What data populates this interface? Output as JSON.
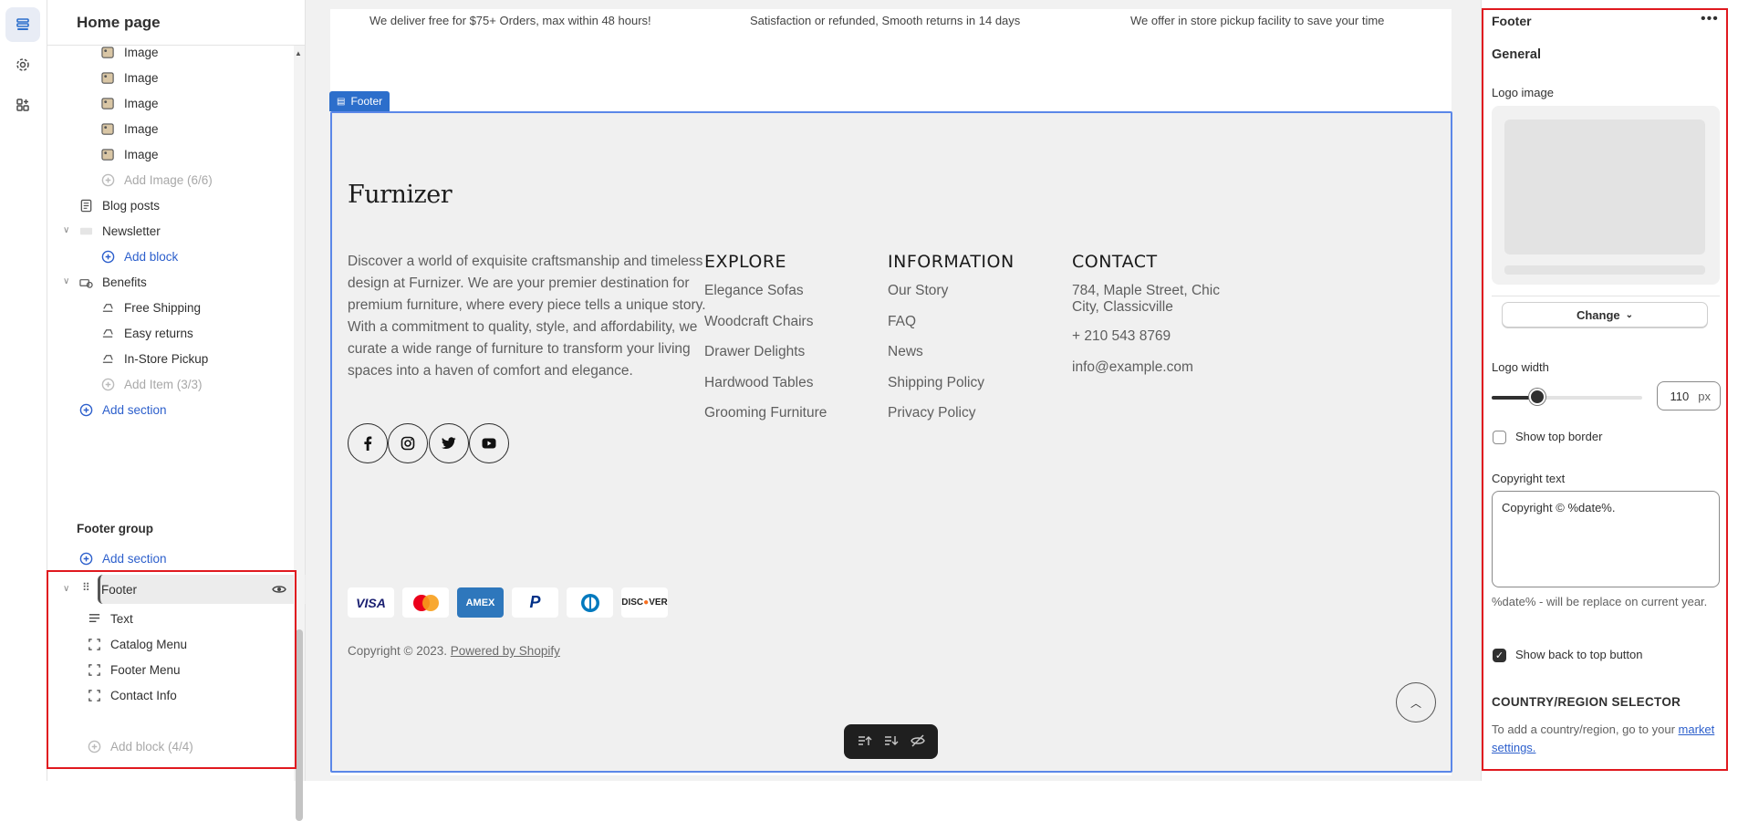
{
  "sidebar": {
    "title": "Home page",
    "tree_top": [
      {
        "label": "Image",
        "icon": "image-thumb-icon"
      },
      {
        "label": "Image",
        "icon": "image-thumb-icon"
      },
      {
        "label": "Image",
        "icon": "image-thumb-icon"
      },
      {
        "label": "Image",
        "icon": "image-thumb-icon"
      },
      {
        "label": "Image",
        "icon": "image-thumb-icon"
      },
      {
        "label": "Add Image (6/6)",
        "icon": "plus-circle-icon"
      },
      {
        "label": "Blog posts",
        "icon": "blog-icon"
      },
      {
        "label": "Newsletter",
        "icon": "newsletter-icon"
      },
      {
        "label": "Add block",
        "icon": "plus-circle-icon"
      },
      {
        "label": "Benefits",
        "icon": "benefits-icon"
      },
      {
        "label": "Free Shipping",
        "icon": "truck-icon"
      },
      {
        "label": "Easy returns",
        "icon": "return-icon"
      },
      {
        "label": "In-Store Pickup",
        "icon": "pickup-icon"
      },
      {
        "label": "Add Item (3/3)",
        "icon": "plus-circle-icon"
      },
      {
        "label": "Add section",
        "icon": "plus-circle-icon"
      }
    ],
    "footer_group": {
      "title": "Footer group",
      "add_section": "Add section",
      "footer": "Footer",
      "blocks": [
        "Text",
        "Catalog Menu",
        "Footer Menu",
        "Contact Info"
      ],
      "add_block": "Add block (4/4)"
    }
  },
  "preview": {
    "benefits": [
      "We deliver free for $75+ Orders, max within 48 hours!",
      "Satisfaction or refunded, Smooth returns in 14 days",
      "We offer in store pickup facility to save your time"
    ],
    "section_tag": "Footer",
    "logo": "Furnizer",
    "about": "Discover a world of exquisite craftsmanship and timeless design at Furnizer. We are your premier destination for premium furniture, where every piece tells a unique story. With a commitment to quality, style, and affordability, we curate a wide range of furniture to transform your living spaces into a haven of comfort and elegance.",
    "columns": [
      {
        "heading": "EXPLORE",
        "items": [
          "Elegance Sofas",
          "Woodcraft Chairs",
          "Drawer Delights",
          "Hardwood Tables",
          "Grooming Furniture"
        ]
      },
      {
        "heading": "INFORMATION",
        "items": [
          "Our Story",
          "FAQ",
          "News",
          "Shipping Policy",
          "Privacy Policy"
        ]
      },
      {
        "heading": "CONTACT",
        "items": [
          "784, Maple Street, Chic City, Classicville",
          "+ 210 543 8769",
          "info@example.com"
        ]
      }
    ],
    "payments": [
      "VISA",
      "Mastercard",
      "AMEX",
      "PayPal",
      "Diners",
      "DISCOVER"
    ],
    "copyright_prefix": "Copyright © 2023. ",
    "copyright_link": "Powered by Shopify"
  },
  "panel": {
    "title": "Footer",
    "more": "•••",
    "general": "General",
    "logo_image": "Logo image",
    "change": "Change",
    "logo_width": "Logo width",
    "logo_width_value": "110",
    "logo_width_unit": "px",
    "logo_width_fraction": 0.3,
    "show_top_border": "Show top border",
    "show_top_border_checked": false,
    "copyright_label": "Copyright text",
    "copyright_value": "Copyright © %date%.",
    "copyright_help": "%date% - will be replace on current year.",
    "show_back_to_top": "Show back to top button",
    "show_back_to_top_checked": true,
    "country_heading": "COUNTRY/REGION SELECTOR",
    "country_text": "To add a country/region, go to your ",
    "country_link": "market settings."
  },
  "colors": {
    "accent": "#2c6ecb",
    "highlight": "#e0191f",
    "footer_bg": "#f0f0f0"
  }
}
